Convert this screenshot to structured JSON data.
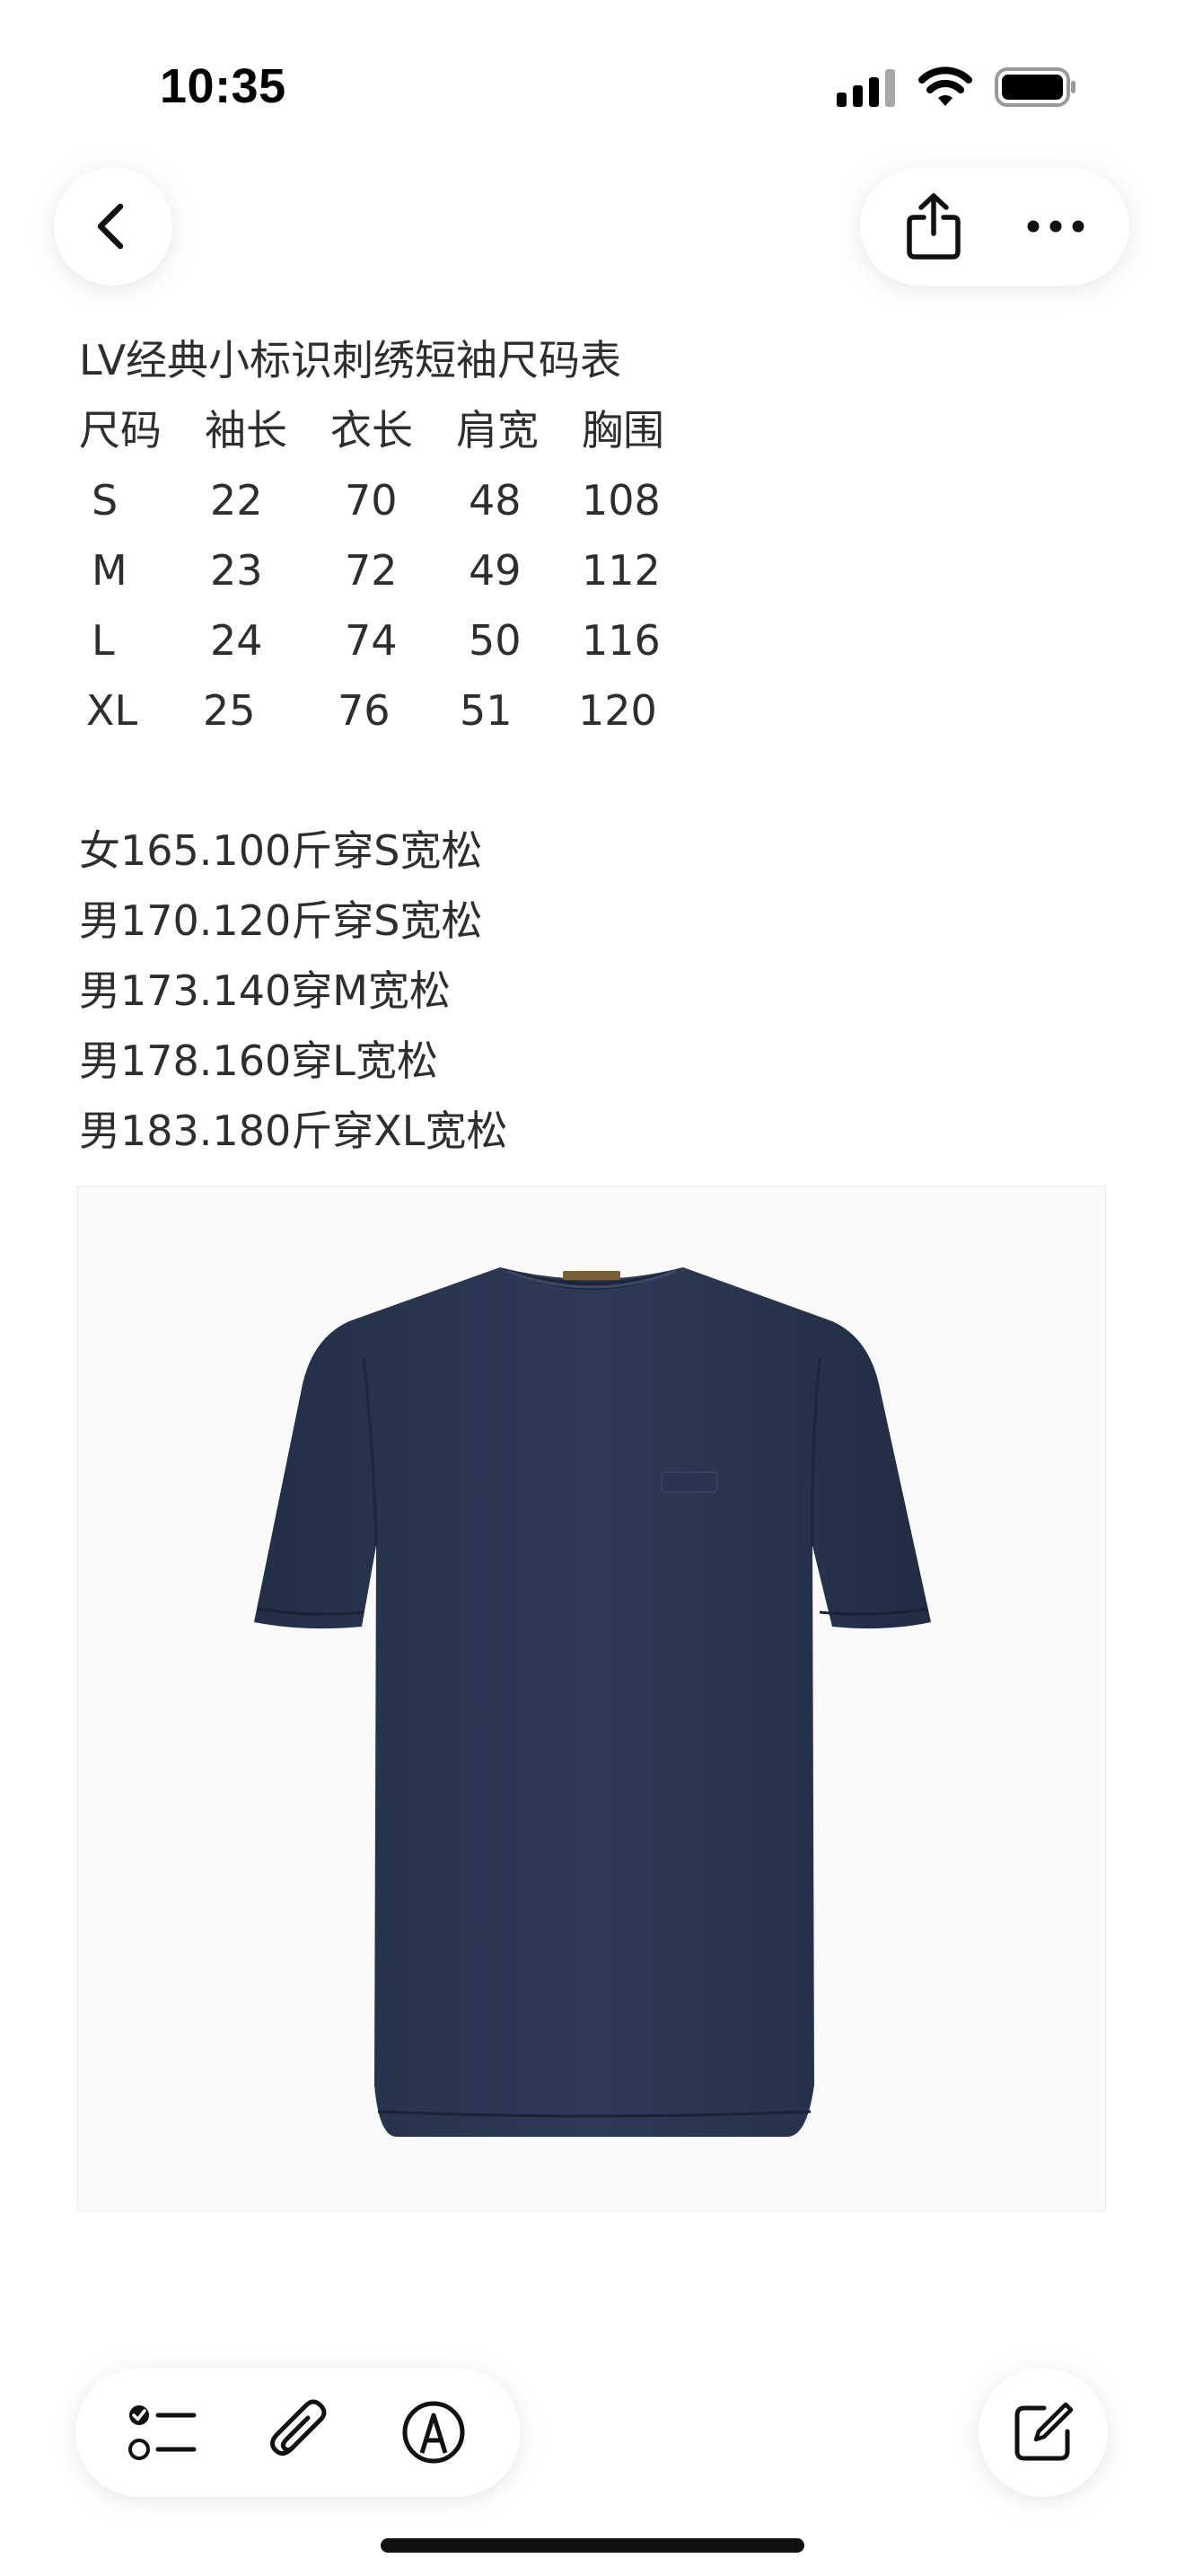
{
  "status_bar": {
    "time": "10:35"
  },
  "toolbar_top": {
    "back_icon": "chevron-left-icon",
    "share_icon": "share-icon",
    "more_icon": "ellipsis-icon"
  },
  "note": {
    "title": "LV经典小标识刺绣短袖尺码表",
    "size_table": {
      "headers": [
        "尺码",
        "袖长",
        "衣长",
        "肩宽",
        "胸围"
      ],
      "rows": [
        [
          "S",
          "22",
          "70",
          "48",
          "108"
        ],
        [
          "M",
          "23",
          "72",
          "49",
          "112"
        ],
        [
          "L",
          "24",
          "74",
          "50",
          "116"
        ],
        [
          "XL",
          "25",
          "76",
          "51",
          "120"
        ]
      ]
    },
    "recommendations": [
      "女165.100斤穿S宽松",
      "男170.120斤穿S宽松",
      "男173.140穿M宽松",
      "男178.160穿L宽松",
      "男183.180斤穿XL宽松"
    ]
  },
  "image": {
    "subject": "navy short-sleeve t-shirt",
    "shirt_color": "#2b3a55",
    "background_color": "#fafafb"
  },
  "toolbar_bottom": {
    "checklist_icon": "checklist-icon",
    "attachment_icon": "paperclip-icon",
    "markup_icon": "pen-markup-icon",
    "compose_icon": "compose-icon"
  }
}
